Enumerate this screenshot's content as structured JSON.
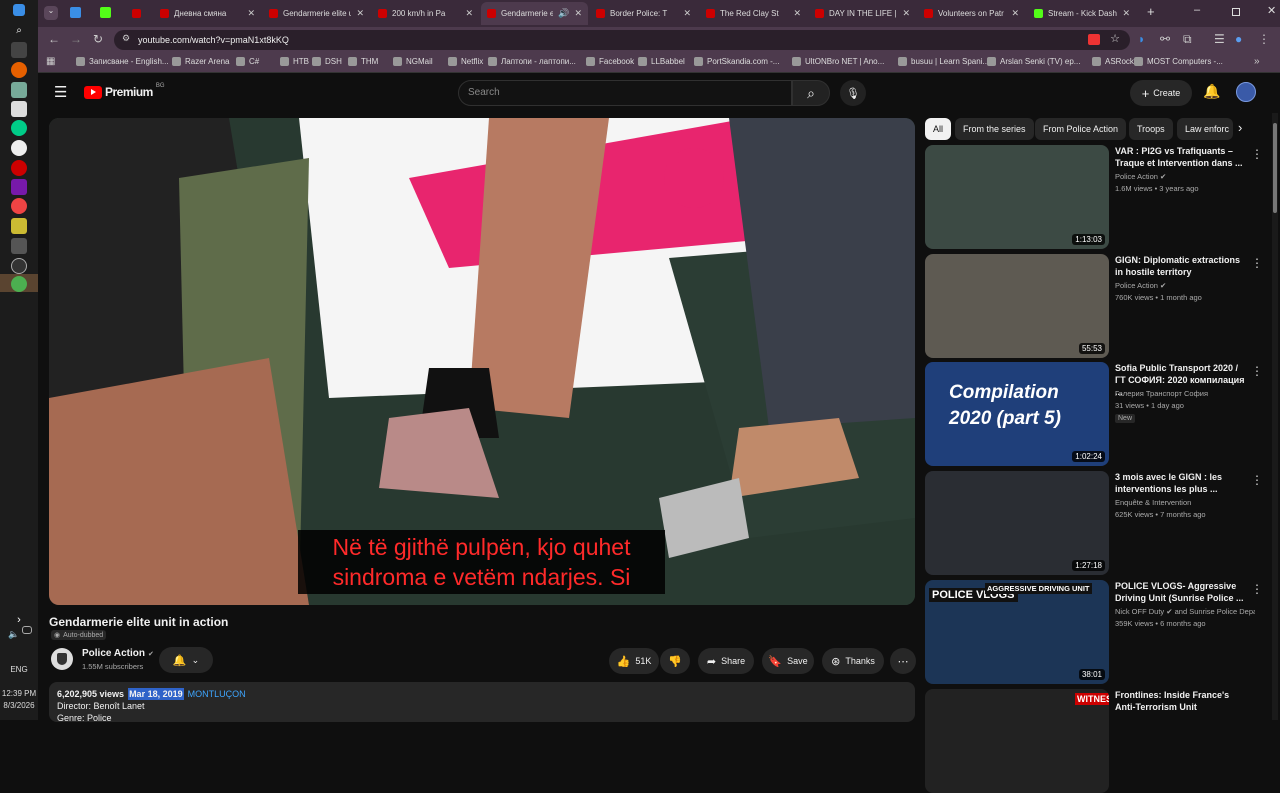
{
  "taskbar": {
    "language": "ENG",
    "time": "12:39 PM",
    "date": "8/3/2026"
  },
  "tabs": [
    {
      "title": "",
      "color": "#c00"
    },
    {
      "title": "Дневна смяна",
      "color": "#c00"
    },
    {
      "title": "Gendarmerie elite u",
      "color": "#c00"
    },
    {
      "title": "200 km/h in Pa",
      "color": "#c00"
    },
    {
      "title": "Gendarmerie eli",
      "color": "#c00",
      "active": true
    },
    {
      "title": "Border Police: T",
      "color": "#c00"
    },
    {
      "title": "The Red Clay St",
      "color": "#c00"
    },
    {
      "title": "DAY IN THE LIFE | K",
      "color": "#c00"
    },
    {
      "title": "Volunteers on Patr",
      "color": "#c00"
    },
    {
      "title": "Stream - Kick Dash",
      "color": "#53fc18"
    }
  ],
  "omnibox": {
    "url": "youtube.com/watch?v=pmaN1xt8kKQ"
  },
  "bookmarks": [
    "Записване - English...",
    "Razer Arena",
    "C#",
    "HTB",
    "DSH",
    "THM",
    "NGMail",
    "Netflix",
    "Лаптопи - лаптопи...",
    "Facebook",
    "LLBabbel",
    "PortSkandia.com -...",
    "UltONBro NET | Ano...",
    "busuu | Learn Spani...",
    "Arslan Senki (TV) ep...",
    "ASRock",
    "MOST Computers -..."
  ],
  "header": {
    "logo": "Premium",
    "logo_sup": "BG",
    "search_placeholder": "Search",
    "create_label": "Create"
  },
  "video": {
    "subtitle_line1": "Në të gjithë pulpën, kjo quhet",
    "subtitle_line2": "sindroma e vetëm ndarjes.  Si",
    "title": "Gendarmerie elite unit in action",
    "auto_dubbed": "Auto-dubbed",
    "channel": "Police Action",
    "subscribers": "1.55M subscribers",
    "likes": "51K",
    "share": "Share",
    "save": "Save",
    "thanks": "Thanks",
    "views": "6,202,905 views",
    "date": "Mar 18, 2019",
    "location": "MONTLUÇON",
    "director": "Director: Benoît Lanet",
    "genre": "Genre: Police"
  },
  "chips": [
    "All",
    "From the series",
    "From Police Action",
    "Troops",
    "Law enforc"
  ],
  "recommendations": [
    {
      "title": "VAR : PI2G vs Trafiquants – Traque et Intervention dans ...",
      "channel": "Police Action",
      "verified": true,
      "meta": "1.6M views • 3 years ago",
      "duration": "1:13:03",
      "bg": "#3c4a44"
    },
    {
      "title": "GIGN: Diplomatic extractions in hostile territory",
      "channel": "Police Action",
      "verified": true,
      "meta": "760K views • 1 month ago",
      "duration": "55:53",
      "bg": "#5e5a52"
    },
    {
      "title": "Sofia Public Transport 2020 / ГТ СОФИЯ: 2020 компилация ...",
      "channel": "Галерия Транспорт София",
      "verified": false,
      "meta": "31 views • 1 day ago",
      "badge": "New",
      "duration": "1:02:24",
      "thumb_text1": "Compilation",
      "thumb_text2": "2020 (part 5)",
      "bg": "#1f3f7a"
    },
    {
      "title": "3 mois avec le GIGN : les interventions les plus ...",
      "channel": "Enquête & Intervention",
      "verified": false,
      "meta": "625K views • 7 months ago",
      "duration": "1:27:18",
      "bg": "#2a2d33"
    },
    {
      "title": "POLICE VLOGS- Aggressive Driving Unit (Sunrise Police ...",
      "channel": "Nick OFF Duty",
      "channel2": "and Sunrise Police Depa...",
      "verified": true,
      "meta": "359K views • 6 months ago",
      "duration": "38:01",
      "thumb_text1": "POLICE VLOGS",
      "thumb_text2": "AGGRESSIVE DRIVING UNIT",
      "bg": "#1c3556"
    },
    {
      "title": "Frontlines: Inside France's Anti-Terrorism Unit",
      "channel": "",
      "verified": false,
      "meta": "",
      "duration": "",
      "thumb_text1": "WITNESS",
      "bg": "#222"
    }
  ]
}
